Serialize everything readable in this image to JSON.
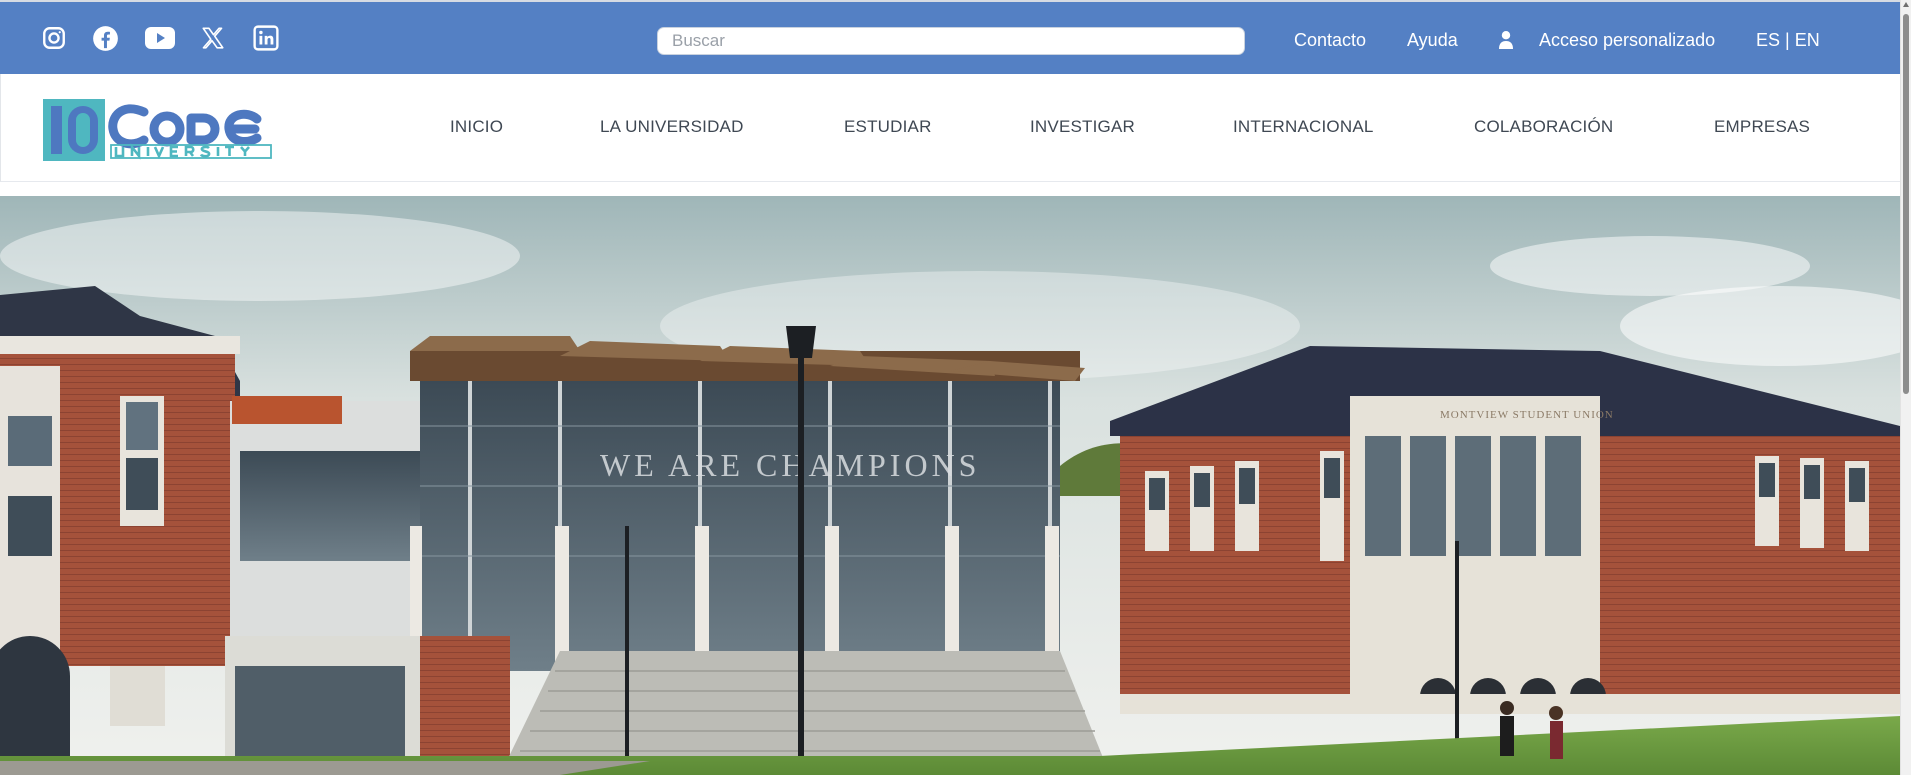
{
  "topbar": {
    "social_icons": [
      "instagram-icon",
      "facebook-icon",
      "youtube-icon",
      "x-twitter-icon",
      "linkedin-icon"
    ],
    "search": {
      "placeholder": "Buscar",
      "value": ""
    },
    "links": {
      "contact": "Contacto",
      "help": "Ayuda",
      "access": "Acceso personalizado",
      "language": "ES | EN"
    },
    "user_icon": "user-icon"
  },
  "logo": {
    "top_text": "Code",
    "bottom_text": "UNIVERSITY"
  },
  "nav": {
    "items": [
      {
        "label": "INICIO"
      },
      {
        "label": "LA UNIVERSIDAD"
      },
      {
        "label": "ESTUDIAR"
      },
      {
        "label": "INVESTIGAR"
      },
      {
        "label": "INTERNACIONAL"
      },
      {
        "label": "COLABORACIÓN"
      },
      {
        "label": "EMPRESAS"
      }
    ]
  },
  "hero": {
    "building_sign": "MONTVIEW STUDENT UNION",
    "glass_lettering": "WE ARE CHAMPIONS"
  },
  "colors": {
    "topbar": "#5480c4",
    "nav_text": "#3f4853",
    "logo_blue": "#4e78c0",
    "logo_teal": "#4fb7c0"
  }
}
